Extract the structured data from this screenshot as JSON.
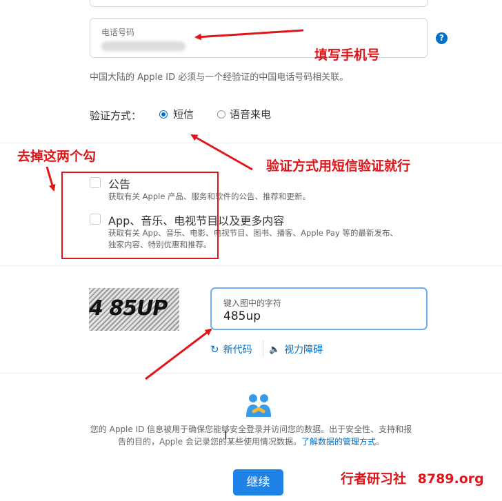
{
  "phone": {
    "label": "电话号码",
    "value_masked": ""
  },
  "phone_note": "中国大陆的 Apple ID 必须与一个经验证的中国电话号码相关联。",
  "verify": {
    "label": "验证方式：",
    "options": [
      "短信",
      "语音来电"
    ],
    "selected": "短信"
  },
  "subscriptions": [
    {
      "title": "公告",
      "desc": "获取有关 Apple 产品、服务和软件的公告、推荐和更新。",
      "checked": false
    },
    {
      "title": "App、音乐、电视节目以及更多内容",
      "desc_line1": "获取有关 App、音乐、电影、电视节目、图书、播客、Apple Pay 等的最新发布、",
      "desc_line2": "独家内容、特别优惠和推荐。",
      "checked": false
    }
  ],
  "captcha": {
    "image_text": "4 85UP",
    "input_label": "键入图中的字符",
    "input_value": "485up",
    "new_code": "新代码",
    "accessibility": "视力障碍"
  },
  "privacy": {
    "line1": "您的 Apple ID 信息被用于确保您能够安全登录并访问您的数据。出于安全性、支持和报",
    "line2_prefix": "告的目的，Apple 会记录您的某些使用情况数据。",
    "link": "了解数据的管理方式",
    "line2_suffix": "。"
  },
  "continue_button": "继续",
  "annotations": {
    "fill_phone": "填写手机号",
    "remove_checks": "去掉这两个勾",
    "verify_sms": "验证方式用短信验证就行"
  },
  "watermark": {
    "text": "行者研习社",
    "domain": "8789.org"
  },
  "colors": {
    "accent": "#0070c9",
    "annotation": "#e0151a",
    "button": "#1e82e6"
  },
  "icons": [
    "help-icon",
    "refresh-icon",
    "speaker-icon",
    "people-icon"
  ]
}
